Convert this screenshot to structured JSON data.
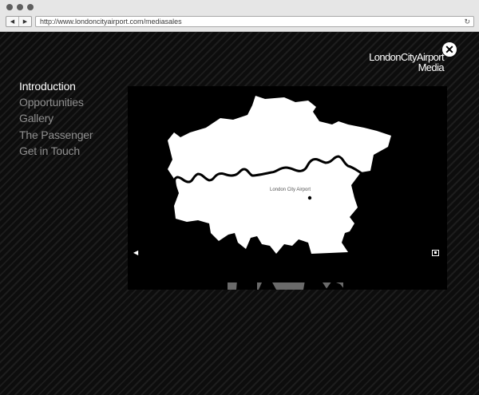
{
  "browser": {
    "nav_back": "◀",
    "nav_forward": "▶",
    "url": "http://www.londoncityairport.com/mediasales",
    "reload_icon": "↻"
  },
  "logo": {
    "line1_london": "London",
    "line1_city": "City",
    "line1_airport": "Airport",
    "line2": "Media"
  },
  "close_icon": "✕",
  "menu": {
    "items": [
      {
        "label": "Introduction",
        "active": true
      },
      {
        "label": "Opportunities",
        "active": false
      },
      {
        "label": "Gallery",
        "active": false
      },
      {
        "label": "The Passenger",
        "active": false
      },
      {
        "label": "Get in Touch",
        "active": false
      }
    ]
  },
  "map": {
    "marker_label": "London City Airport"
  },
  "video_controls": {
    "volume_icon": "◀",
    "fullscreen_icon": "fullscreen-icon"
  },
  "colors": {
    "chrome_bg": "#e6e6e6",
    "page_bg": "#0d0d0d",
    "menu_active": "#ffffff",
    "menu_inactive": "#8f8f8f",
    "map_fill": "#ffffff",
    "progress_bar": "#6a6a6a"
  }
}
